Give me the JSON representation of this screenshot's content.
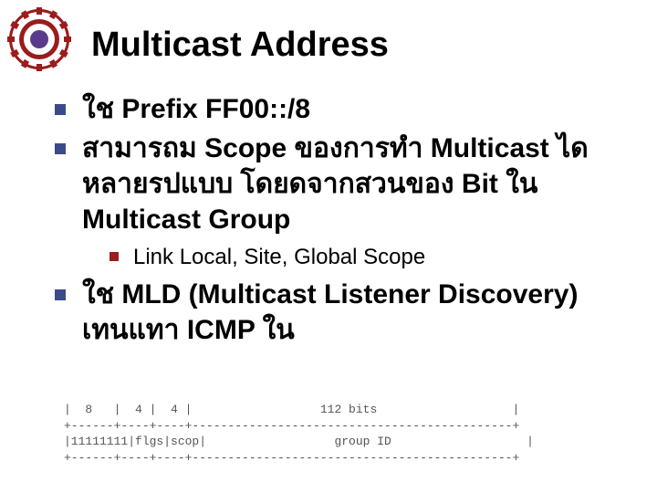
{
  "title": "Multicast Address",
  "bullets": [
    {
      "level": 1,
      "text": "ใช   Prefix FF00::/8"
    },
    {
      "level": 1,
      "text": "สามารถม   Scope ของการทำ Multicast ไดหลายรปแบบ โดยดจากสวนของ    Bit ใน Multicast Group"
    },
    {
      "level": 2,
      "text": "Link Local, Site, Global Scope"
    },
    {
      "level": 1,
      "text": "ใช   MLD (Multicast Listener Discovery) เทนแทา    ICMP ใน"
    }
  ],
  "diagram": {
    "line1": "|  8   |  4 |  4 |                  112 bits                   |",
    "line2": "+------+----+----+---------------------------------------------+",
    "line3": "|11111111|flgs|scop|                  group ID                   |",
    "line4": "+------+----+----+---------------------------------------------+"
  }
}
